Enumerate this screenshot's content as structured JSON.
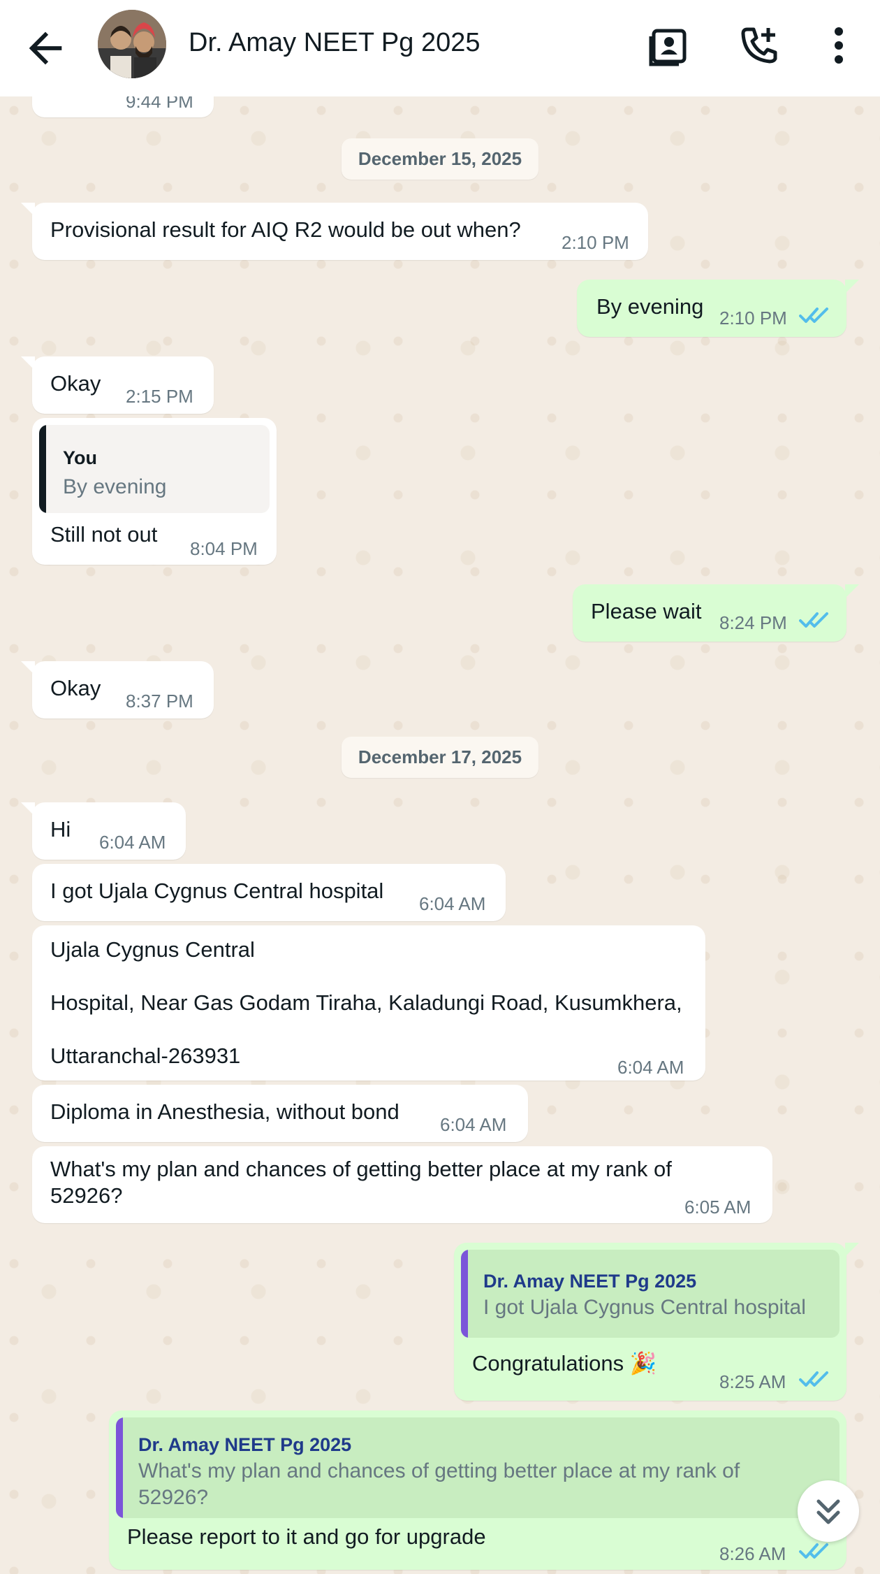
{
  "header": {
    "contact_name": "Dr. Amay NEET Pg 2025"
  },
  "icons": {
    "back": "arrow-left-icon",
    "video": "contact-card-icon",
    "call": "add-call-icon",
    "menu": "more-vert-icon"
  },
  "colors": {
    "incoming_bubble": "#ffffff",
    "outgoing_bubble": "#d9fdd3",
    "read_ticks": "#53bdeb",
    "quote_bar_self": "#111b21",
    "quote_bar_contact": "#7b55d9"
  },
  "chat": {
    "top_partial_time": "9:44 PM",
    "dates": {
      "d1": "December 15, 2025",
      "d2": "December 17, 2025"
    },
    "messages": [
      {
        "dir": "in",
        "text": "Provisional result for AIQ R2 would be out when?",
        "time": "2:10 PM"
      },
      {
        "dir": "out",
        "text": "By evening",
        "time": "2:10 PM",
        "status": "read"
      },
      {
        "dir": "in",
        "text": "Okay",
        "time": "2:15 PM"
      },
      {
        "dir": "in",
        "quote_author": "You",
        "quote_text": "By evening",
        "text": "Still not out",
        "time": "8:04 PM"
      },
      {
        "dir": "out",
        "text": "Please wait",
        "time": "8:24 PM",
        "status": "read"
      },
      {
        "dir": "in",
        "text": "Okay",
        "time": "8:37 PM"
      },
      {
        "dir": "in",
        "text": "Hi",
        "time": "6:04 AM"
      },
      {
        "dir": "in",
        "text": "I got Ujala Cygnus Central hospital",
        "time": "6:04 AM"
      },
      {
        "dir": "in",
        "text_line1": "Ujala Cygnus Central",
        "text_line2": "Hospital, Near Gas Godam Tiraha, Kaladungi Road, Kusumkhera,",
        "text_line3": "Uttaranchal-263931",
        "time": "6:04 AM"
      },
      {
        "dir": "in",
        "text": "Diploma in Anesthesia, without bond",
        "time": "6:04 AM"
      },
      {
        "dir": "in",
        "text_line1": "What's my plan and chances of getting better place at my rank of",
        "text_line2": "52926?",
        "time": "6:05 AM"
      },
      {
        "dir": "out",
        "quote_author": "Dr. Amay NEET Pg 2025",
        "quote_text": "I got Ujala Cygnus Central hospital",
        "text": "Congratulations 🎉",
        "time": "8:25 AM",
        "status": "read"
      },
      {
        "dir": "out",
        "quote_author": "Dr. Amay NEET Pg 2025",
        "quote_text_line1": "What's my plan and chances of getting better place at my rank of",
        "quote_text_line2": "52926?",
        "text": "Please report to it and go for upgrade",
        "time": "8:26 AM",
        "status": "read"
      }
    ]
  }
}
